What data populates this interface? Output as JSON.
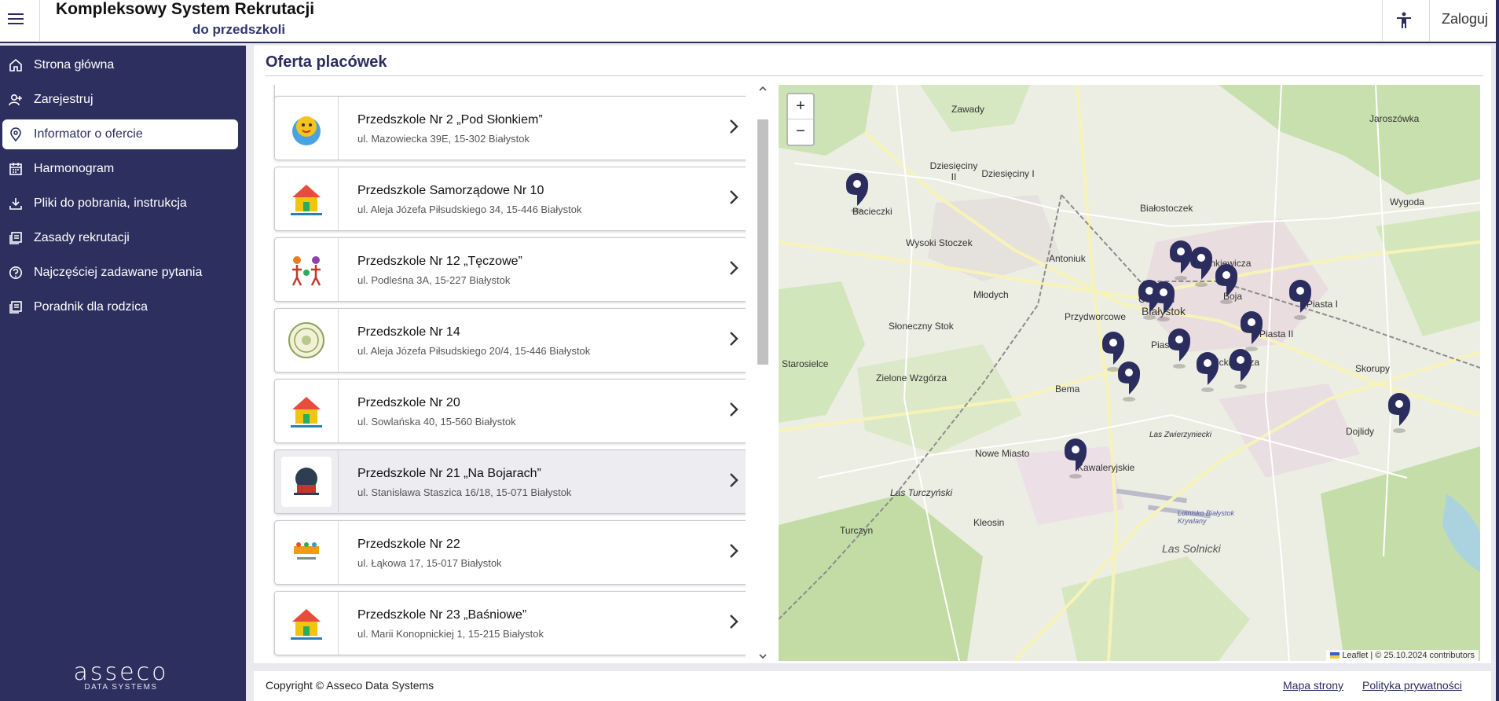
{
  "header": {
    "title": "Kompleksowy System Rekrutacji",
    "subtitle": "do przedszkoli",
    "login_label": "Zaloguj"
  },
  "sidebar": {
    "items": [
      {
        "label": "Strona główna",
        "icon": "home-icon"
      },
      {
        "label": "Zarejestruj",
        "icon": "add-user-icon"
      },
      {
        "label": "Informator o ofercie",
        "icon": "location-pin-icon",
        "active": true
      },
      {
        "label": "Harmonogram",
        "icon": "calendar-icon"
      },
      {
        "label": "Pliki do pobrania, instrukcja",
        "icon": "download-icon"
      },
      {
        "label": "Zasady rekrutacji",
        "icon": "document-list-icon"
      },
      {
        "label": "Najczęściej zadawane pytania",
        "icon": "help-icon"
      },
      {
        "label": "Poradnik dla rodzica",
        "icon": "document-list-icon"
      }
    ],
    "logo_text": "asseco",
    "logo_sub": "DATA SYSTEMS"
  },
  "main": {
    "title": "Oferta placówek",
    "preschools": [
      {
        "name": "Przedszkole Nr 2 „Pod Słonkiem”",
        "address": "ul. Mazowiecka 39E, 15-302 Białystok"
      },
      {
        "name": "Przedszkole Samorządowe Nr 10",
        "address": "ul. Aleja Józefa Piłsudskiego 34, 15-446 Białystok"
      },
      {
        "name": "Przedszkole Nr 12 „Tęczowe”",
        "address": "ul. Podleśna 3A, 15-227 Białystok"
      },
      {
        "name": "Przedszkole Nr 14",
        "address": "ul. Aleja Józefa Piłsudskiego 20/4, 15-446 Białystok"
      },
      {
        "name": "Przedszkole Nr 20",
        "address": "ul. Sowlańska 40, 15-560 Białystok"
      },
      {
        "name": "Przedszkole Nr 21 „Na Bojarach”",
        "address": "ul. Stanisława Staszica 16/18, 15-071 Białystok"
      },
      {
        "name": "Przedszkole Nr 22",
        "address": "ul. Łąkowa 17, 15-017 Białystok"
      },
      {
        "name": "Przedszkole Nr 23 „Baśniowe”",
        "address": "ul. Marii Konopnickiej 1, 15-215 Białystok"
      }
    ]
  },
  "map": {
    "zoom_in": "+",
    "zoom_out": "−",
    "attribution_leaflet": "Leaflet",
    "attribution_text": "| © 25.10.2024 contributors",
    "places": [
      "Zawady",
      "Jaroszówka",
      "Dziesięciny II",
      "Dziesięciny I",
      "Bacieczki",
      "Wygoda",
      "Białostoczek",
      "Wysoki Stoczek",
      "Antoniuk",
      "Sienkiewicza",
      "Młodych",
      "Centrum",
      "Boja",
      "Białystok",
      "Przydworcowe",
      "Piasta I",
      "Słoneczny Stok",
      "Piaski",
      "Piasta II",
      "Starosielce",
      "Mickiewicza",
      "Skorupy",
      "Zielone Wzgórza",
      "Bema",
      "Dojlidy",
      "Nowe Miasto",
      "Kawaleryjskie",
      "Las Zwierzyniecki",
      "Las Turczyński",
      "Kleosin",
      "Turczyn",
      "Las Solnicki",
      "Lotnisko Białystok Krywlany"
    ]
  },
  "footer": {
    "copyright": "Copyright © Asseco Data Systems",
    "sitemap": "Mapa strony",
    "privacy": "Polityka prywatności"
  },
  "colors": {
    "navy": "#2d2f5f",
    "marker": "#2b2d5e"
  }
}
